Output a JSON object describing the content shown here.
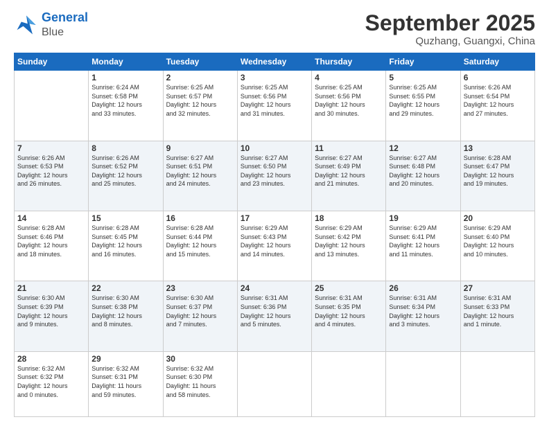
{
  "logo": {
    "line1": "General",
    "line2": "Blue"
  },
  "title": "September 2025",
  "subtitle": "Quzhang, Guangxi, China",
  "days_of_week": [
    "Sunday",
    "Monday",
    "Tuesday",
    "Wednesday",
    "Thursday",
    "Friday",
    "Saturday"
  ],
  "weeks": [
    [
      {
        "num": "",
        "info": ""
      },
      {
        "num": "1",
        "info": "Sunrise: 6:24 AM\nSunset: 6:58 PM\nDaylight: 12 hours\nand 33 minutes."
      },
      {
        "num": "2",
        "info": "Sunrise: 6:25 AM\nSunset: 6:57 PM\nDaylight: 12 hours\nand 32 minutes."
      },
      {
        "num": "3",
        "info": "Sunrise: 6:25 AM\nSunset: 6:56 PM\nDaylight: 12 hours\nand 31 minutes."
      },
      {
        "num": "4",
        "info": "Sunrise: 6:25 AM\nSunset: 6:56 PM\nDaylight: 12 hours\nand 30 minutes."
      },
      {
        "num": "5",
        "info": "Sunrise: 6:25 AM\nSunset: 6:55 PM\nDaylight: 12 hours\nand 29 minutes."
      },
      {
        "num": "6",
        "info": "Sunrise: 6:26 AM\nSunset: 6:54 PM\nDaylight: 12 hours\nand 27 minutes."
      }
    ],
    [
      {
        "num": "7",
        "info": "Sunrise: 6:26 AM\nSunset: 6:53 PM\nDaylight: 12 hours\nand 26 minutes."
      },
      {
        "num": "8",
        "info": "Sunrise: 6:26 AM\nSunset: 6:52 PM\nDaylight: 12 hours\nand 25 minutes."
      },
      {
        "num": "9",
        "info": "Sunrise: 6:27 AM\nSunset: 6:51 PM\nDaylight: 12 hours\nand 24 minutes."
      },
      {
        "num": "10",
        "info": "Sunrise: 6:27 AM\nSunset: 6:50 PM\nDaylight: 12 hours\nand 23 minutes."
      },
      {
        "num": "11",
        "info": "Sunrise: 6:27 AM\nSunset: 6:49 PM\nDaylight: 12 hours\nand 21 minutes."
      },
      {
        "num": "12",
        "info": "Sunrise: 6:27 AM\nSunset: 6:48 PM\nDaylight: 12 hours\nand 20 minutes."
      },
      {
        "num": "13",
        "info": "Sunrise: 6:28 AM\nSunset: 6:47 PM\nDaylight: 12 hours\nand 19 minutes."
      }
    ],
    [
      {
        "num": "14",
        "info": "Sunrise: 6:28 AM\nSunset: 6:46 PM\nDaylight: 12 hours\nand 18 minutes."
      },
      {
        "num": "15",
        "info": "Sunrise: 6:28 AM\nSunset: 6:45 PM\nDaylight: 12 hours\nand 16 minutes."
      },
      {
        "num": "16",
        "info": "Sunrise: 6:28 AM\nSunset: 6:44 PM\nDaylight: 12 hours\nand 15 minutes."
      },
      {
        "num": "17",
        "info": "Sunrise: 6:29 AM\nSunset: 6:43 PM\nDaylight: 12 hours\nand 14 minutes."
      },
      {
        "num": "18",
        "info": "Sunrise: 6:29 AM\nSunset: 6:42 PM\nDaylight: 12 hours\nand 13 minutes."
      },
      {
        "num": "19",
        "info": "Sunrise: 6:29 AM\nSunset: 6:41 PM\nDaylight: 12 hours\nand 11 minutes."
      },
      {
        "num": "20",
        "info": "Sunrise: 6:29 AM\nSunset: 6:40 PM\nDaylight: 12 hours\nand 10 minutes."
      }
    ],
    [
      {
        "num": "21",
        "info": "Sunrise: 6:30 AM\nSunset: 6:39 PM\nDaylight: 12 hours\nand 9 minutes."
      },
      {
        "num": "22",
        "info": "Sunrise: 6:30 AM\nSunset: 6:38 PM\nDaylight: 12 hours\nand 8 minutes."
      },
      {
        "num": "23",
        "info": "Sunrise: 6:30 AM\nSunset: 6:37 PM\nDaylight: 12 hours\nand 7 minutes."
      },
      {
        "num": "24",
        "info": "Sunrise: 6:31 AM\nSunset: 6:36 PM\nDaylight: 12 hours\nand 5 minutes."
      },
      {
        "num": "25",
        "info": "Sunrise: 6:31 AM\nSunset: 6:35 PM\nDaylight: 12 hours\nand 4 minutes."
      },
      {
        "num": "26",
        "info": "Sunrise: 6:31 AM\nSunset: 6:34 PM\nDaylight: 12 hours\nand 3 minutes."
      },
      {
        "num": "27",
        "info": "Sunrise: 6:31 AM\nSunset: 6:33 PM\nDaylight: 12 hours\nand 1 minute."
      }
    ],
    [
      {
        "num": "28",
        "info": "Sunrise: 6:32 AM\nSunset: 6:32 PM\nDaylight: 12 hours\nand 0 minutes."
      },
      {
        "num": "29",
        "info": "Sunrise: 6:32 AM\nSunset: 6:31 PM\nDaylight: 11 hours\nand 59 minutes."
      },
      {
        "num": "30",
        "info": "Sunrise: 6:32 AM\nSunset: 6:30 PM\nDaylight: 11 hours\nand 58 minutes."
      },
      {
        "num": "",
        "info": ""
      },
      {
        "num": "",
        "info": ""
      },
      {
        "num": "",
        "info": ""
      },
      {
        "num": "",
        "info": ""
      }
    ]
  ]
}
